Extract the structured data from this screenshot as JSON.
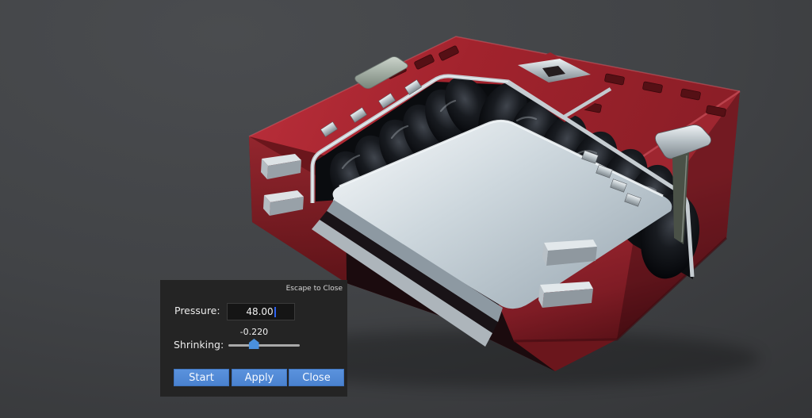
{
  "viewport": {
    "scene": "red-case-with-inflated-cushion-seal-and-silver-tray",
    "colors": {
      "background_center": "#4a4c4f",
      "background_edge": "#2f3032",
      "case_red_top": "#a2232d",
      "case_red_left": "#6e1a20",
      "case_red_front": "#8c1f29",
      "case_red_dark": "#5e1318",
      "cushion_black": "#0a0c0f",
      "tray_silver": "#cdd7dd",
      "rim_silver": "#c6cdd2",
      "metal_silver": "#b9c2c7"
    }
  },
  "dialog": {
    "escape_hint": "Escape to Close",
    "pressure": {
      "label": "Pressure:",
      "value": "48.00"
    },
    "shrinking": {
      "label": "Shrinking:",
      "value": "-0.220",
      "slider_percent": 36
    },
    "buttons": {
      "start": "Start",
      "apply": "Apply",
      "close": "Close"
    },
    "colors": {
      "panel_bg": "#242424",
      "field_bg": "#151515",
      "button_blue": "#4f88d5",
      "caret_blue": "#2e63f2",
      "handle_blue": "#4a90dd",
      "track_gray": "#a9a9a9"
    }
  }
}
